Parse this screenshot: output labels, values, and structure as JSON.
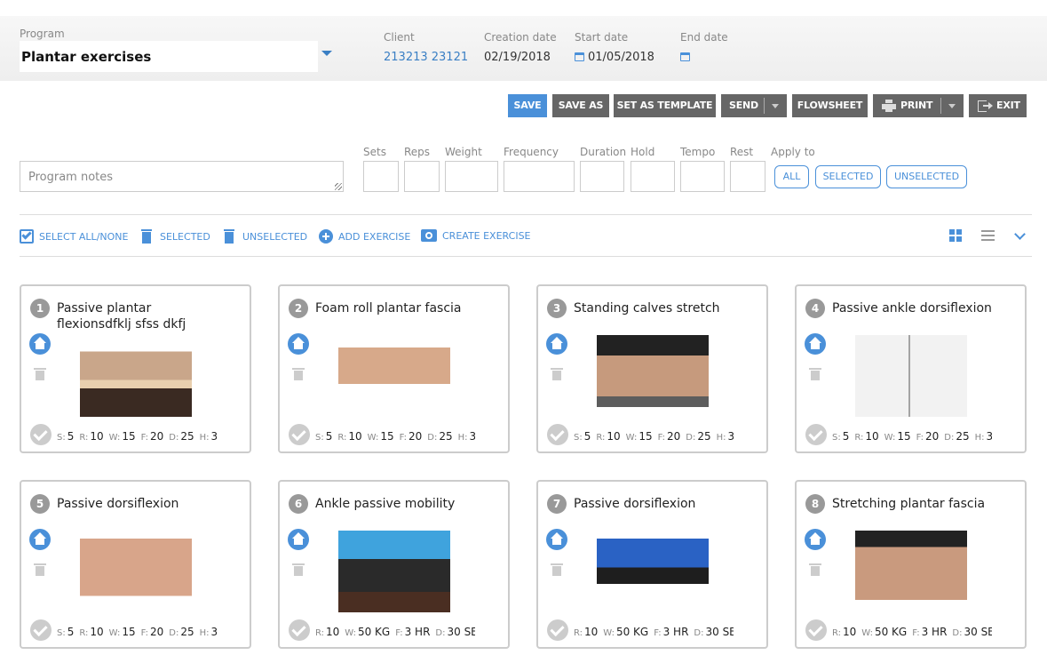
{
  "header": {
    "program_label": "Program",
    "program_value": "Plantar exercises",
    "client_label": "Client",
    "client_value": "213213 23121",
    "creation_label": "Creation date",
    "creation_value": "02/19/2018",
    "start_label": "Start date",
    "start_value": "01/05/2018",
    "end_label": "End date",
    "end_value": ""
  },
  "toolbar": {
    "save": "SAVE",
    "save_as": "SAVE AS",
    "set_template": "SET AS TEMPLATE",
    "send": "SEND",
    "flowsheet": "FLOWSHEET",
    "print": "PRINT",
    "exit": "EXIT"
  },
  "params_form": {
    "notes_placeholder": "Program notes",
    "sets": "Sets",
    "reps": "Reps",
    "weight": "Weight",
    "frequency": "Frequency",
    "duration": "Duration",
    "hold": "Hold",
    "tempo": "Tempo",
    "rest": "Rest",
    "apply_to": "Apply to",
    "apply_all": "ALL",
    "apply_selected": "SELECTED",
    "apply_unselected": "UNSELECTED"
  },
  "actions": {
    "select_all": "SELECT ALL/NONE",
    "delete_selected": "SELECTED",
    "delete_unselected": "UNSELECTED",
    "add_exercise": "ADD EXERCISE",
    "create_exercise": "CREATE EXERCISE"
  },
  "colors": {
    "accent": "#4a90d9",
    "button_dark": "#666666",
    "muted": "#cccccc"
  },
  "exercises": [
    {
      "num": "1",
      "title": "Passive plantar flexionsdfklj sfss dkfj",
      "image": "seated-foot-stretch",
      "params": [
        [
          "S:",
          "5"
        ],
        [
          "R:",
          "10"
        ],
        [
          "W:",
          "15"
        ],
        [
          "F:",
          "20"
        ],
        [
          "D:",
          "25"
        ],
        [
          "H:",
          "3"
        ]
      ]
    },
    {
      "num": "2",
      "title": "Foam roll plantar fascia",
      "image": "foam-roller-foot",
      "params": [
        [
          "S:",
          "5"
        ],
        [
          "R:",
          "10"
        ],
        [
          "W:",
          "15"
        ],
        [
          "F:",
          "20"
        ],
        [
          "D:",
          "25"
        ],
        [
          "H:",
          "3"
        ]
      ]
    },
    {
      "num": "3",
      "title": "Standing calves stretch",
      "image": "step-calf-stretch",
      "params": [
        [
          "S:",
          "5"
        ],
        [
          "R:",
          "10"
        ],
        [
          "W:",
          "15"
        ],
        [
          "F:",
          "20"
        ],
        [
          "D:",
          "25"
        ],
        [
          "H:",
          "3"
        ]
      ]
    },
    {
      "num": "4",
      "title": "Passive ankle dorsiflexion",
      "image": "wall-ankle-stretch",
      "params": [
        [
          "S:",
          "5"
        ],
        [
          "R:",
          "10"
        ],
        [
          "W:",
          "15"
        ],
        [
          "F:",
          "20"
        ],
        [
          "D:",
          "25"
        ],
        [
          "H:",
          "3"
        ]
      ]
    },
    {
      "num": "5",
      "title": "Passive dorsiflexion",
      "image": "band-dorsiflexion",
      "params": [
        [
          "S:",
          "5"
        ],
        [
          "R:",
          "10"
        ],
        [
          "W:",
          "15"
        ],
        [
          "F:",
          "20"
        ],
        [
          "D:",
          "25"
        ],
        [
          "H:",
          "3"
        ]
      ]
    },
    {
      "num": "6",
      "title": "Ankle passive mobility",
      "image": "seated-ankle-mobility",
      "params": [
        [
          "R:",
          "10"
        ],
        [
          "W:",
          "50 KG"
        ],
        [
          "F:",
          "3 HR"
        ],
        [
          "D:",
          "30 SE"
        ]
      ]
    },
    {
      "num": "7",
      "title": "Passive dorsiflexion",
      "image": "kneeling-dorsiflexion",
      "params": [
        [
          "R:",
          "10"
        ],
        [
          "W:",
          "50 KG"
        ],
        [
          "F:",
          "3 HR"
        ],
        [
          "D:",
          "30 SE"
        ]
      ]
    },
    {
      "num": "8",
      "title": "Stretching plantar fascia",
      "image": "wall-plantar-stretch",
      "params": [
        [
          "R:",
          "10"
        ],
        [
          "W:",
          "50 KG"
        ],
        [
          "F:",
          "3 HR"
        ],
        [
          "D:",
          "30 SE"
        ]
      ]
    }
  ]
}
